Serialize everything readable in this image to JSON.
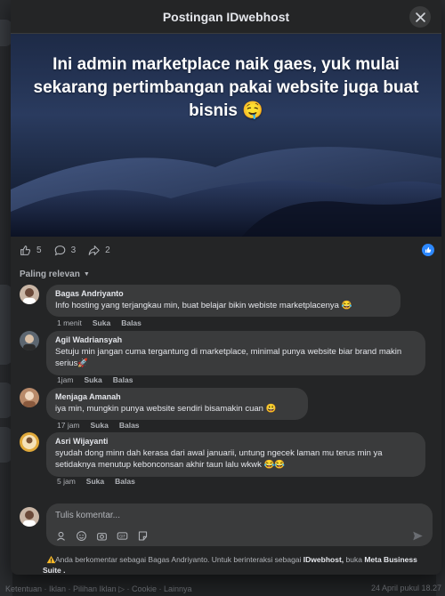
{
  "modal": {
    "title": "Postingan IDwebhost"
  },
  "post": {
    "text": "Ini admin marketplace naik gaes, yuk mulai sekarang pertimbangan pakai website juga buat bisnis 🤤"
  },
  "stats": {
    "reactions": "5",
    "comments": "3",
    "shares": "2"
  },
  "sort": {
    "label": "Paling relevan"
  },
  "comments": [
    {
      "name": "Bagas Andriyanto",
      "text": "Info hosting yang terjangkau min, buat belajar bikin webiste marketplacenya 😂",
      "time": "1 menit",
      "like": "Suka",
      "reply": "Balas"
    },
    {
      "name": "Agil Wadriansyah",
      "text": "Setuju min jangan cuma tergantung di marketplace, minimal punya website biar brand makin serius🚀",
      "time": "1jam",
      "like": "Suka",
      "reply": "Balas"
    },
    {
      "name": "Menjaga Amanah",
      "text": "iya min, mungkin punya website sendiri bisamakin cuan 😃",
      "time": "17 jam",
      "like": "Suka",
      "reply": "Balas"
    },
    {
      "name": "Asri Wijayanti",
      "text": "syudah dong minn dah kerasa dari awal januarii, untung ngecek laman mu terus min ya setidaknya menutup kebonconsan akhir taun lalu wkwk 😂😂",
      "time": "5 jam",
      "like": "Suka",
      "reply": "Balas"
    }
  ],
  "composer": {
    "placeholder": "Tulis komentar..."
  },
  "notice": {
    "prefix": "Anda berkomentar sebagai Bagas Andriyanto. Untuk berinteraksi sebagai",
    "page": "IDwebhost,",
    "middle": "buka",
    "tool": "Meta Business Suite ."
  },
  "background": {
    "footer_left": "Ketentuan · Iklan · Pilihan Iklan ▷ · Cookie · Lainnya",
    "footer_right": "24 April pukul 18.27"
  },
  "colors": {
    "accent": "#2d88ff",
    "bubble": "#3a3b3c",
    "modal_bg": "#242526",
    "warning": "#f7b928"
  }
}
